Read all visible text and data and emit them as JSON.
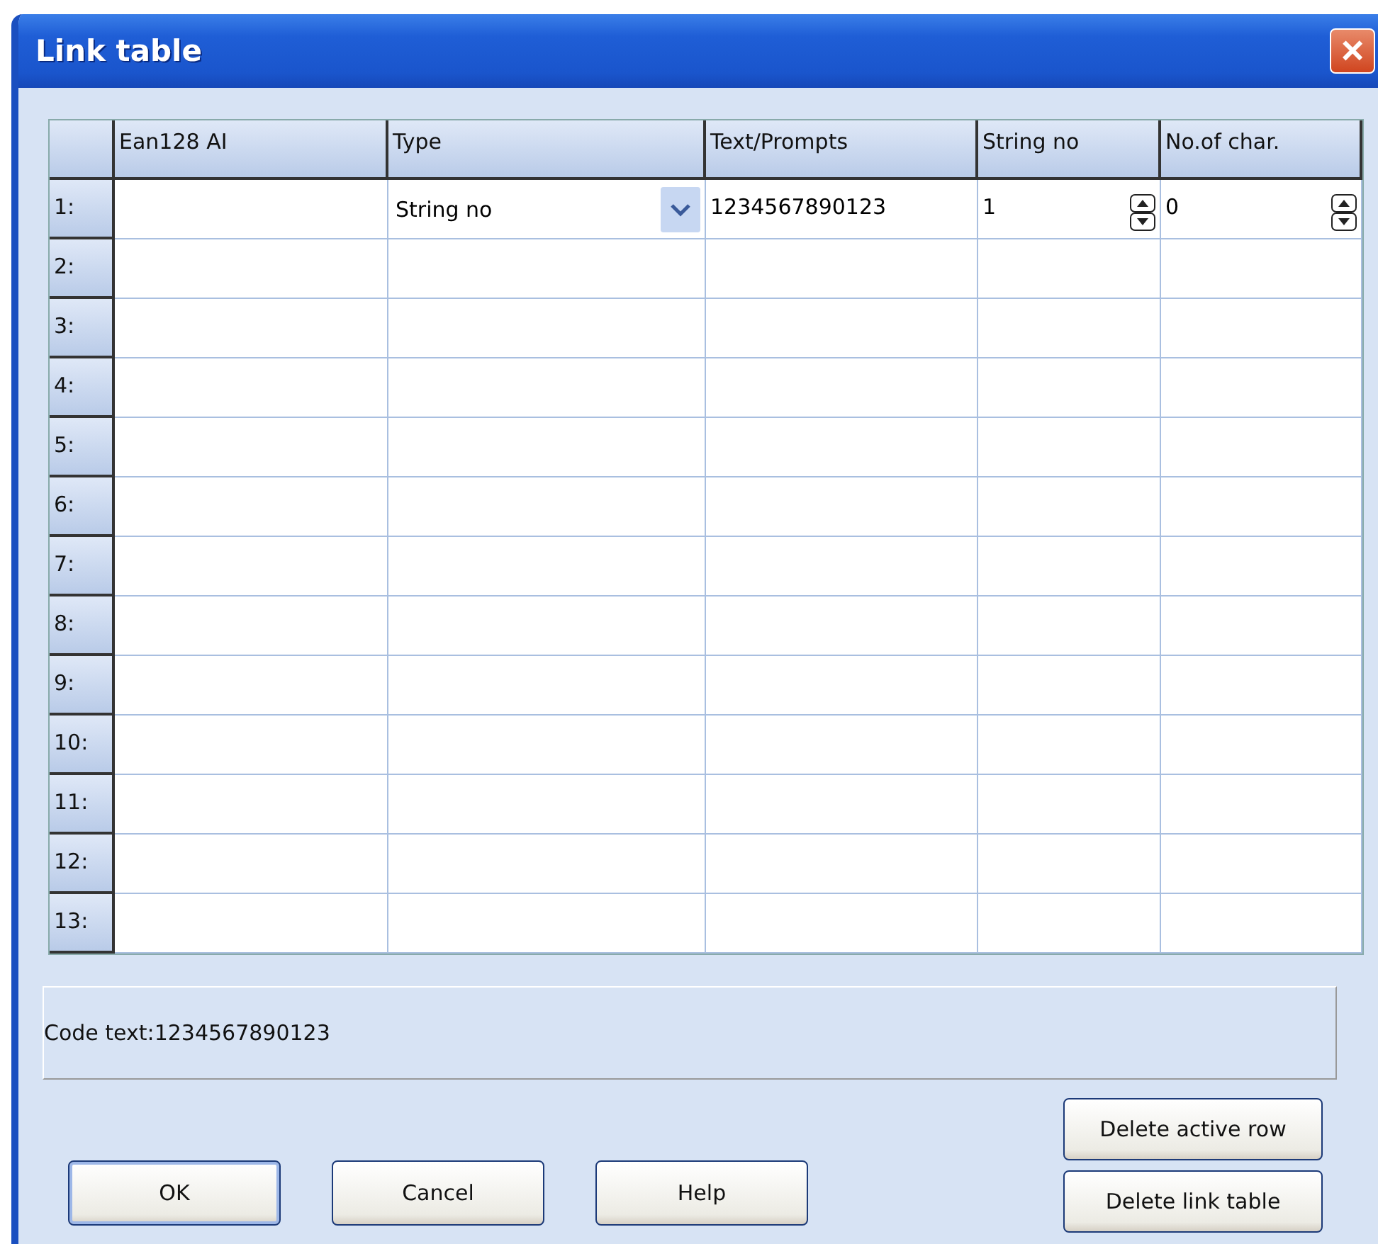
{
  "window": {
    "title": "Link table",
    "close_label": "×"
  },
  "table": {
    "columns": [
      "Ean128 AI",
      "Type",
      "Text/Prompts",
      "String no",
      "No.of char."
    ],
    "rows": [
      {
        "number": "1:",
        "editing": true,
        "type": "String no",
        "text": "1234567890123",
        "string_no": "1",
        "chars": "0"
      },
      {
        "number": "2:",
        "editing": false
      },
      {
        "number": "3:",
        "editing": false
      },
      {
        "number": "4:",
        "editing": false
      },
      {
        "number": "5:",
        "editing": false
      },
      {
        "number": "6:",
        "editing": false
      },
      {
        "number": "7:",
        "editing": false
      },
      {
        "number": "8:",
        "editing": false
      },
      {
        "number": "9:",
        "editing": false
      },
      {
        "number": "10:",
        "editing": false
      },
      {
        "number": "11:",
        "editing": false
      },
      {
        "number": "12:",
        "editing": false
      },
      {
        "number": "13:",
        "editing": false
      }
    ]
  },
  "code_text": "Code text:1234567890123",
  "buttons": [
    "OK",
    "Cancel",
    "Help"
  ],
  "side_buttons": [
    "Delete active row",
    "Delete link table"
  ]
}
